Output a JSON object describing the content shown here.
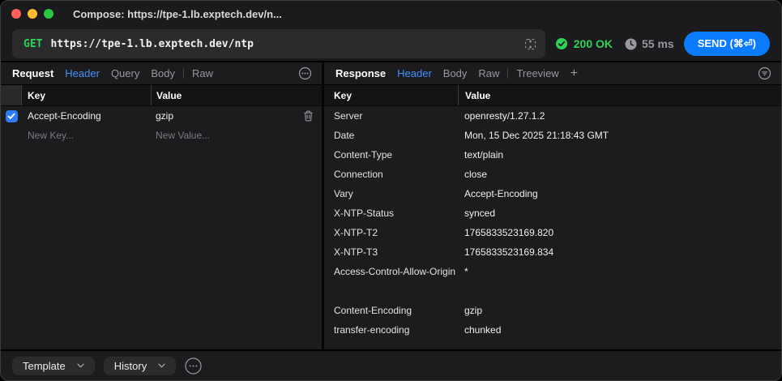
{
  "titlebar": {
    "title": "Compose: https://tpe-1.lb.exptech.dev/n..."
  },
  "url_bar": {
    "method": "GET",
    "url": "https://tpe-1.lb.exptech.dev/ntp",
    "status": "200 OK",
    "time": "55 ms",
    "send_label": "SEND (⌘⏎)"
  },
  "request_panel": {
    "label": "Request",
    "tabs": [
      {
        "label": "Header",
        "active": true
      },
      {
        "label": "Query"
      },
      {
        "label": "Body"
      },
      {
        "label": "Raw"
      }
    ],
    "table": {
      "columns": {
        "key": "Key",
        "value": "Value"
      },
      "rows": [
        {
          "key": "Accept-Encoding",
          "value": "gzip",
          "checked": true
        }
      ],
      "new_key_placeholder": "New Key...",
      "new_value_placeholder": "New Value..."
    }
  },
  "response_panel": {
    "label": "Response",
    "tabs": [
      {
        "label": "Header",
        "active": true
      },
      {
        "label": "Body"
      },
      {
        "label": "Raw"
      },
      {
        "label": "Treeview"
      }
    ],
    "add_tab_label": "+",
    "table": {
      "columns": {
        "key": "Key",
        "value": "Value"
      },
      "rows": [
        {
          "key": "Server",
          "value": "openresty/1.27.1.2"
        },
        {
          "key": "Date",
          "value": "Mon, 15 Dec 2025 21:18:43 GMT"
        },
        {
          "key": "Content-Type",
          "value": "text/plain"
        },
        {
          "key": "Connection",
          "value": "close"
        },
        {
          "key": "Vary",
          "value": "Accept-Encoding"
        },
        {
          "key": "X-NTP-Status",
          "value": "synced"
        },
        {
          "key": "X-NTP-T2",
          "value": "1765833523169.820"
        },
        {
          "key": "X-NTP-T3",
          "value": "1765833523169.834"
        },
        {
          "key": "Access-Control-Allow-Origin",
          "value": "*"
        },
        {
          "key": "",
          "value": ""
        },
        {
          "key": "Content-Encoding",
          "value": "gzip"
        },
        {
          "key": "transfer-encoding",
          "value": "chunked"
        }
      ]
    }
  },
  "footer": {
    "template_label": "Template",
    "history_label": "History"
  },
  "colors": {
    "method_green": "#30d158",
    "status_green": "#30d158",
    "send_blue": "#0a7aff",
    "active_tab_blue": "#4291ff",
    "checkbox_blue": "#2e7bf6",
    "traffic_red": "#ff5f57",
    "traffic_yellow": "#febc2e",
    "traffic_green": "#28c840"
  }
}
